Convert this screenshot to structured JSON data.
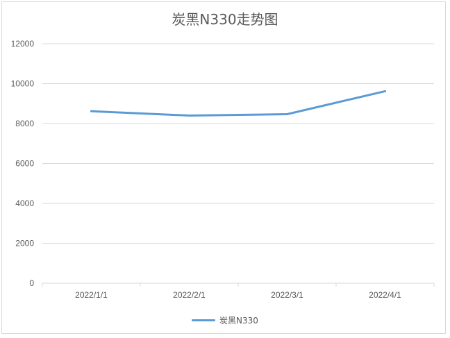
{
  "chart_data": {
    "type": "line",
    "title": "炭黑N330走势图",
    "categories": [
      "2022/1/1",
      "2022/2/1",
      "2022/3/1",
      "2022/4/1"
    ],
    "series": [
      {
        "name": "炭黑N330",
        "values": [
          8620,
          8400,
          8470,
          9620
        ],
        "color": "#5b9bd5"
      }
    ],
    "yticks": [
      "0",
      "2000",
      "4000",
      "6000",
      "8000",
      "10000",
      "12000"
    ],
    "ylim": [
      0,
      12000
    ],
    "grid": true,
    "legend": "bottom"
  }
}
